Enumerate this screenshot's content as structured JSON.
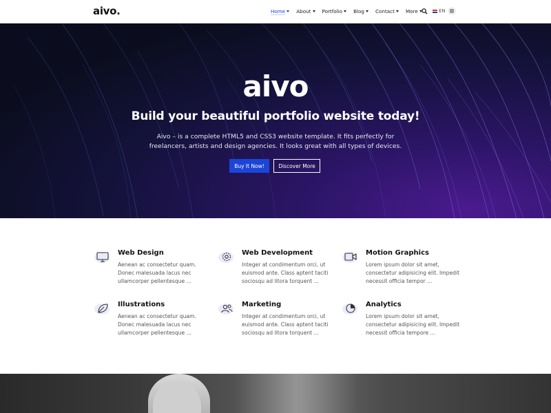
{
  "nav": {
    "logo": "aivo.",
    "items": [
      {
        "label": "Home",
        "active": true
      },
      {
        "label": "About"
      },
      {
        "label": "Portfolio"
      },
      {
        "label": "Blog"
      },
      {
        "label": "Contact"
      },
      {
        "label": "More"
      }
    ],
    "search_icon": "search-icon",
    "language": "EN",
    "menu_icon": "hamburger-icon"
  },
  "hero": {
    "title": "aivo",
    "subtitle": "Build your beautiful portfolio website today!",
    "description_line1": "Aivo – is a complete HTML5 and CSS3 website template. It fits perfectly for",
    "description_line2": "freelancers, artists and design agencies. It looks great with all types of devices.",
    "primary_button": "Buy It Now!",
    "secondary_button": "Discover More",
    "colors": {
      "primary": "#1b45d8",
      "background": "#0b0d1e",
      "accent": "#4b1a8f"
    }
  },
  "services": [
    {
      "title": "Web Design",
      "icon": "monitor-icon",
      "text": "Aenean ac consectetur quam. Donec malesuada lacus nec ullamcorper pellentesque ..."
    },
    {
      "title": "Web Development",
      "icon": "gear-icon",
      "text": "Integer at condimentum orci, ut euismod ante. Class aptent taciti sociosqu ad litora torquent ..."
    },
    {
      "title": "Motion Graphics",
      "icon": "video-camera-icon",
      "text": "Lorem ipsum dolor sit amet, consectetur adipisicing elit. Impedit necessit officia tempor ..."
    },
    {
      "title": "Illustrations",
      "icon": "leaf-icon",
      "text": "Aenean ac consectetur quam. Donec malesuada lacus nec ullamcorper pellentesque ..."
    },
    {
      "title": "Marketing",
      "icon": "users-icon",
      "text": "Integer at condimentum orci, ut euismod ante. Class aptent taciti sociosqu ad litora torquent ..."
    },
    {
      "title": "Analytics",
      "icon": "pie-chart-icon",
      "text": "Lorem ipsum dolor sit amet, consectetur adipisicing elit. Impedit necessit officia tempore ..."
    }
  ]
}
